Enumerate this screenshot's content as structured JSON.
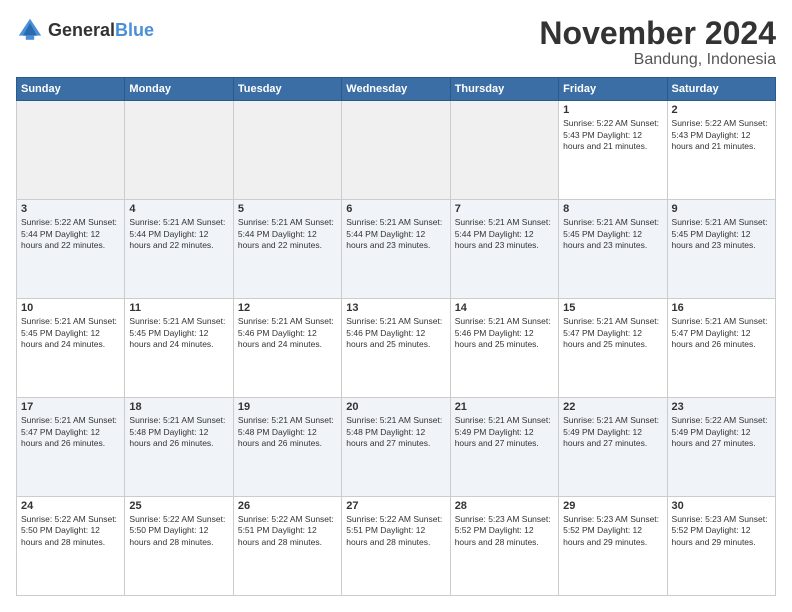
{
  "logo": {
    "text_general": "General",
    "text_blue": "Blue"
  },
  "header": {
    "title": "November 2024",
    "subtitle": "Bandung, Indonesia"
  },
  "days_of_week": [
    "Sunday",
    "Monday",
    "Tuesday",
    "Wednesday",
    "Thursday",
    "Friday",
    "Saturday"
  ],
  "weeks": [
    [
      {
        "day": "",
        "info": ""
      },
      {
        "day": "",
        "info": ""
      },
      {
        "day": "",
        "info": ""
      },
      {
        "day": "",
        "info": ""
      },
      {
        "day": "",
        "info": ""
      },
      {
        "day": "1",
        "info": "Sunrise: 5:22 AM\nSunset: 5:43 PM\nDaylight: 12 hours\nand 21 minutes."
      },
      {
        "day": "2",
        "info": "Sunrise: 5:22 AM\nSunset: 5:43 PM\nDaylight: 12 hours\nand 21 minutes."
      }
    ],
    [
      {
        "day": "3",
        "info": "Sunrise: 5:22 AM\nSunset: 5:44 PM\nDaylight: 12 hours\nand 22 minutes."
      },
      {
        "day": "4",
        "info": "Sunrise: 5:21 AM\nSunset: 5:44 PM\nDaylight: 12 hours\nand 22 minutes."
      },
      {
        "day": "5",
        "info": "Sunrise: 5:21 AM\nSunset: 5:44 PM\nDaylight: 12 hours\nand 22 minutes."
      },
      {
        "day": "6",
        "info": "Sunrise: 5:21 AM\nSunset: 5:44 PM\nDaylight: 12 hours\nand 23 minutes."
      },
      {
        "day": "7",
        "info": "Sunrise: 5:21 AM\nSunset: 5:44 PM\nDaylight: 12 hours\nand 23 minutes."
      },
      {
        "day": "8",
        "info": "Sunrise: 5:21 AM\nSunset: 5:45 PM\nDaylight: 12 hours\nand 23 minutes."
      },
      {
        "day": "9",
        "info": "Sunrise: 5:21 AM\nSunset: 5:45 PM\nDaylight: 12 hours\nand 23 minutes."
      }
    ],
    [
      {
        "day": "10",
        "info": "Sunrise: 5:21 AM\nSunset: 5:45 PM\nDaylight: 12 hours\nand 24 minutes."
      },
      {
        "day": "11",
        "info": "Sunrise: 5:21 AM\nSunset: 5:45 PM\nDaylight: 12 hours\nand 24 minutes."
      },
      {
        "day": "12",
        "info": "Sunrise: 5:21 AM\nSunset: 5:46 PM\nDaylight: 12 hours\nand 24 minutes."
      },
      {
        "day": "13",
        "info": "Sunrise: 5:21 AM\nSunset: 5:46 PM\nDaylight: 12 hours\nand 25 minutes."
      },
      {
        "day": "14",
        "info": "Sunrise: 5:21 AM\nSunset: 5:46 PM\nDaylight: 12 hours\nand 25 minutes."
      },
      {
        "day": "15",
        "info": "Sunrise: 5:21 AM\nSunset: 5:47 PM\nDaylight: 12 hours\nand 25 minutes."
      },
      {
        "day": "16",
        "info": "Sunrise: 5:21 AM\nSunset: 5:47 PM\nDaylight: 12 hours\nand 26 minutes."
      }
    ],
    [
      {
        "day": "17",
        "info": "Sunrise: 5:21 AM\nSunset: 5:47 PM\nDaylight: 12 hours\nand 26 minutes."
      },
      {
        "day": "18",
        "info": "Sunrise: 5:21 AM\nSunset: 5:48 PM\nDaylight: 12 hours\nand 26 minutes."
      },
      {
        "day": "19",
        "info": "Sunrise: 5:21 AM\nSunset: 5:48 PM\nDaylight: 12 hours\nand 26 minutes."
      },
      {
        "day": "20",
        "info": "Sunrise: 5:21 AM\nSunset: 5:48 PM\nDaylight: 12 hours\nand 27 minutes."
      },
      {
        "day": "21",
        "info": "Sunrise: 5:21 AM\nSunset: 5:49 PM\nDaylight: 12 hours\nand 27 minutes."
      },
      {
        "day": "22",
        "info": "Sunrise: 5:21 AM\nSunset: 5:49 PM\nDaylight: 12 hours\nand 27 minutes."
      },
      {
        "day": "23",
        "info": "Sunrise: 5:22 AM\nSunset: 5:49 PM\nDaylight: 12 hours\nand 27 minutes."
      }
    ],
    [
      {
        "day": "24",
        "info": "Sunrise: 5:22 AM\nSunset: 5:50 PM\nDaylight: 12 hours\nand 28 minutes."
      },
      {
        "day": "25",
        "info": "Sunrise: 5:22 AM\nSunset: 5:50 PM\nDaylight: 12 hours\nand 28 minutes."
      },
      {
        "day": "26",
        "info": "Sunrise: 5:22 AM\nSunset: 5:51 PM\nDaylight: 12 hours\nand 28 minutes."
      },
      {
        "day": "27",
        "info": "Sunrise: 5:22 AM\nSunset: 5:51 PM\nDaylight: 12 hours\nand 28 minutes."
      },
      {
        "day": "28",
        "info": "Sunrise: 5:23 AM\nSunset: 5:52 PM\nDaylight: 12 hours\nand 28 minutes."
      },
      {
        "day": "29",
        "info": "Sunrise: 5:23 AM\nSunset: 5:52 PM\nDaylight: 12 hours\nand 29 minutes."
      },
      {
        "day": "30",
        "info": "Sunrise: 5:23 AM\nSunset: 5:52 PM\nDaylight: 12 hours\nand 29 minutes."
      }
    ]
  ],
  "colors": {
    "header_bg": "#3a6ea5",
    "alt_row": "#f5f7fa",
    "empty_cell": "#f0f0f0"
  }
}
